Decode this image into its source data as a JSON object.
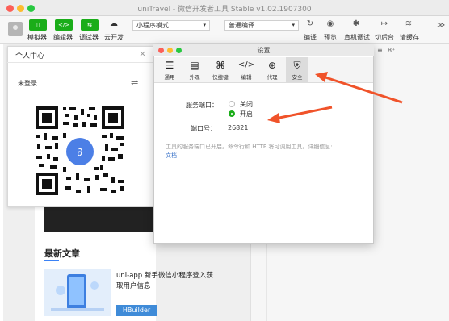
{
  "window": {
    "title": "uniTravel - 微信开发者工具 Stable v1.02.1907300"
  },
  "toolbar": {
    "left_buttons": [
      {
        "icon_text": "▯",
        "label": "模拟器"
      },
      {
        "icon_text": "</>",
        "label": "编辑器"
      },
      {
        "icon_text": "⇆",
        "label": "调试器"
      },
      {
        "icon_text": "☁",
        "label": "云开发"
      }
    ],
    "mode_select": "小程序模式",
    "compile_select": "普通编译",
    "right_buttons": [
      {
        "icon_text": "↻",
        "label": "编译"
      },
      {
        "icon_text": "◉",
        "label": "预览"
      },
      {
        "icon_text": "✱",
        "label": "真机调试"
      },
      {
        "icon_text": "↦",
        "label": "切后台"
      },
      {
        "icon_text": "≋",
        "label": "清缓存"
      }
    ],
    "more": "≫"
  },
  "personal_center": {
    "title": "个人中心",
    "status": "未登录",
    "close": "×",
    "switch": "⇌"
  },
  "article": {
    "section_title": "最新文章",
    "text": "uni-app 新手微信小程序登入获取用户信息",
    "badge": "HBuilder"
  },
  "editor": {
    "tool1": "≡",
    "tool2": "8⁺"
  },
  "settings": {
    "title": "设置",
    "tabs": [
      {
        "icon": "☰",
        "label": "通用"
      },
      {
        "icon": "▤",
        "label": "外观"
      },
      {
        "icon": "⌘",
        "label": "快捷键"
      },
      {
        "icon": "</>",
        "label": "编辑"
      },
      {
        "icon": "⊕",
        "label": "代理"
      },
      {
        "icon": "⛨",
        "label": "安全"
      }
    ],
    "service_port_label": "服务端口：",
    "off_label": "关闭",
    "on_label": "开启",
    "port_label": "端口号：",
    "port_value": "26821",
    "info_text": "工具的服务端口已开启。命令行和 HTTP 将可调用工具。详细信息:",
    "doc_link": "文档"
  },
  "colors": {
    "accent_green": "#1aad19",
    "arrow_orange": "#f0532a",
    "link_blue": "#3b73c8"
  }
}
